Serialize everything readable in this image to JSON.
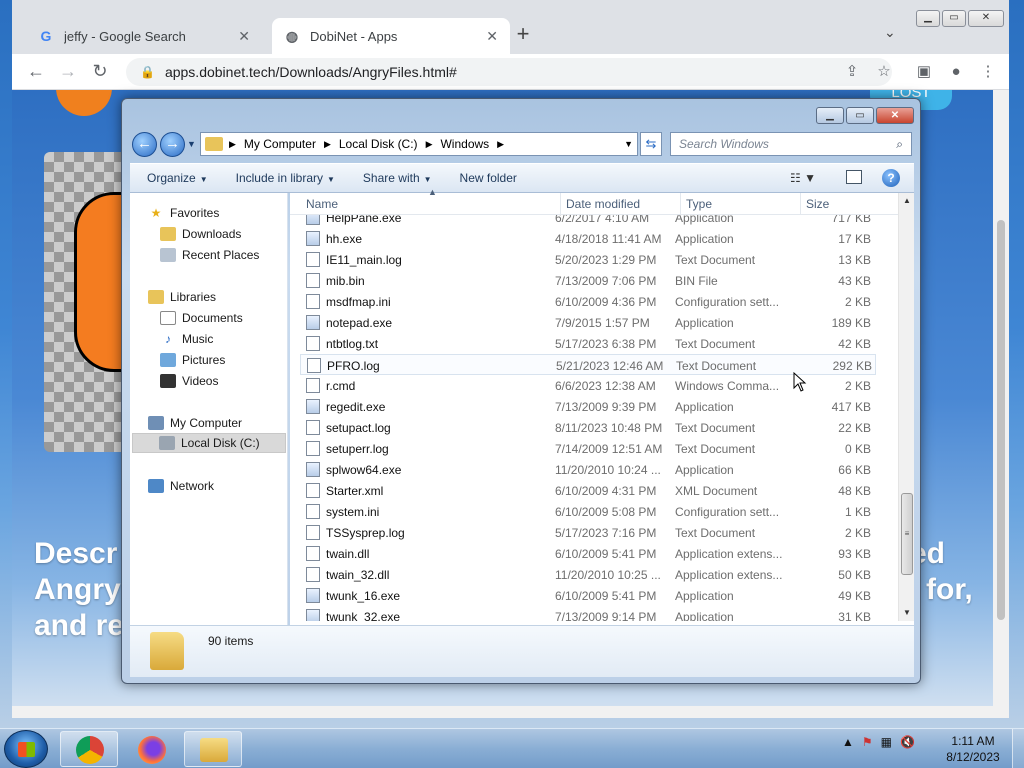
{
  "browser": {
    "tabs": [
      {
        "title": "jeffy - Google Search",
        "favicon": "google-g"
      },
      {
        "title": "DobiNet - Apps",
        "favicon": "globe"
      }
    ],
    "url": "apps.dobinet.tech/Downloads/AngryFiles.html#"
  },
  "webpage": {
    "heading_line1_left": "Descr",
    "heading_line1_right": "ed",
    "heading_line2_left": "Angry",
    "heading_line2_right": "for,",
    "heading_line3_left": "and re",
    "badge": "LOST"
  },
  "explorer": {
    "breadcrumb": [
      "My Computer",
      "Local Disk (C:)",
      "Windows"
    ],
    "search_placeholder": "Search Windows",
    "commands": {
      "organize": "Organize",
      "include": "Include in library",
      "share": "Share with",
      "newfolder": "New folder"
    },
    "nav": {
      "favorites": "Favorites",
      "downloads": "Downloads",
      "recent": "Recent Places",
      "libraries": "Libraries",
      "documents": "Documents",
      "music": "Music",
      "pictures": "Pictures",
      "videos": "Videos",
      "mycomputer": "My Computer",
      "localdisk": "Local Disk (C:)",
      "network": "Network"
    },
    "columns": {
      "name": "Name",
      "date": "Date modified",
      "type": "Type",
      "size": "Size"
    },
    "files": [
      {
        "name": "HelpPane.exe",
        "date": "6/2/2017 4:10 AM",
        "type": "Application",
        "size": "717 KB",
        "kind": "exe"
      },
      {
        "name": "hh.exe",
        "date": "4/18/2018 11:41 AM",
        "type": "Application",
        "size": "17 KB",
        "kind": "exe"
      },
      {
        "name": "IE11_main.log",
        "date": "5/20/2023 1:29 PM",
        "type": "Text Document",
        "size": "13 KB",
        "kind": "txt"
      },
      {
        "name": "mib.bin",
        "date": "7/13/2009 7:06 PM",
        "type": "BIN File",
        "size": "43 KB",
        "kind": "txt"
      },
      {
        "name": "msdfmap.ini",
        "date": "6/10/2009 4:36 PM",
        "type": "Configuration sett...",
        "size": "2 KB",
        "kind": "txt"
      },
      {
        "name": "notepad.exe",
        "date": "7/9/2015 1:57 PM",
        "type": "Application",
        "size": "189 KB",
        "kind": "exe"
      },
      {
        "name": "ntbtlog.txt",
        "date": "5/17/2023 6:38 PM",
        "type": "Text Document",
        "size": "42 KB",
        "kind": "txt"
      },
      {
        "name": "PFRO.log",
        "date": "5/21/2023 12:46 AM",
        "type": "Text Document",
        "size": "292 KB",
        "kind": "txt"
      },
      {
        "name": "r.cmd",
        "date": "6/6/2023 12:38 AM",
        "type": "Windows Comma...",
        "size": "2 KB",
        "kind": "txt"
      },
      {
        "name": "regedit.exe",
        "date": "7/13/2009 9:39 PM",
        "type": "Application",
        "size": "417 KB",
        "kind": "exe"
      },
      {
        "name": "setupact.log",
        "date": "8/11/2023 10:48 PM",
        "type": "Text Document",
        "size": "22 KB",
        "kind": "txt"
      },
      {
        "name": "setuperr.log",
        "date": "7/14/2009 12:51 AM",
        "type": "Text Document",
        "size": "0 KB",
        "kind": "txt"
      },
      {
        "name": "splwow64.exe",
        "date": "11/20/2010 10:24 ...",
        "type": "Application",
        "size": "66 KB",
        "kind": "exe"
      },
      {
        "name": "Starter.xml",
        "date": "6/10/2009 4:31 PM",
        "type": "XML Document",
        "size": "48 KB",
        "kind": "txt"
      },
      {
        "name": "system.ini",
        "date": "6/10/2009 5:08 PM",
        "type": "Configuration sett...",
        "size": "1 KB",
        "kind": "txt"
      },
      {
        "name": "TSSysprep.log",
        "date": "5/17/2023 7:16 PM",
        "type": "Text Document",
        "size": "2 KB",
        "kind": "txt"
      },
      {
        "name": "twain.dll",
        "date": "6/10/2009 5:41 PM",
        "type": "Application extens...",
        "size": "93 KB",
        "kind": "txt"
      },
      {
        "name": "twain_32.dll",
        "date": "11/20/2010 10:25 ...",
        "type": "Application extens...",
        "size": "50 KB",
        "kind": "txt"
      },
      {
        "name": "twunk_16.exe",
        "date": "6/10/2009 5:41 PM",
        "type": "Application",
        "size": "49 KB",
        "kind": "exe"
      },
      {
        "name": "twunk_32.exe",
        "date": "7/13/2009 9:14 PM",
        "type": "Application",
        "size": "31 KB",
        "kind": "exe"
      }
    ],
    "item_count": "90 items"
  },
  "taskbar": {
    "time": "1:11 AM",
    "date": "8/12/2023"
  }
}
